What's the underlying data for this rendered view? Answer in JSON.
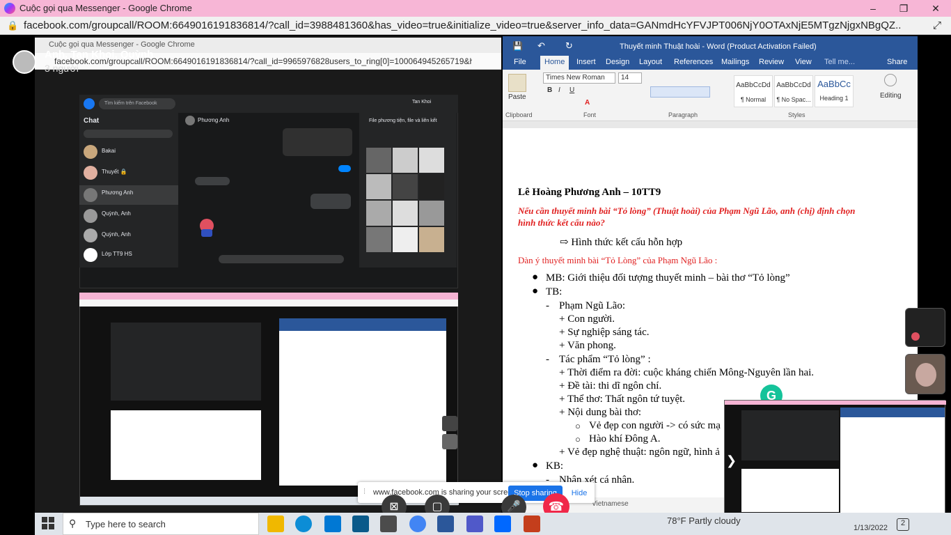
{
  "window": {
    "title": "Cuộc gọi qua Messenger - Google Chrome",
    "minimize": "–",
    "maximize": "❐",
    "close": "✕"
  },
  "address": {
    "lock": "🔒",
    "url": "facebook.com/groupcall/ROOM:6649016191836814/?call_id=3988481360&has_video=true&initialize_video=true&server_info_data=GANmdHcYFVJPT006NjY0OTAxNjE5MTgzNjgxNBgQZ...",
    "ext": "⤢"
  },
  "call": {
    "participants": "Anh, Tan Khoi, Quỳnh",
    "count": "3 người"
  },
  "shared_chrome": {
    "title": "Cuộc gọi qua Messenger - Google Chrome",
    "url": "facebook.com/groupcall/ROOM:6649016191836814/?call_id=9965976828users_to_ring[0]=100064945265719&h..."
  },
  "fb": {
    "search_placeholder": "Tìm kiếm trên Facebook",
    "chat_title": "Chat",
    "contact_name": "Phương Anh",
    "user_name": "Tan Khoi",
    "files_title": "File phương tiện, file và liên kết",
    "chats": [
      {
        "name": "Bakai"
      },
      {
        "name": "Thuyết 🔒"
      },
      {
        "name": "Phương Anh"
      },
      {
        "name": "Quỳnh, Anh"
      },
      {
        "name": "Quỳnh, Anh"
      },
      {
        "name": "Lớp TT9 HS"
      }
    ]
  },
  "word": {
    "title": "Thuyết minh Thuật hoài - Word (Product Activation Failed)",
    "tabs": [
      "File",
      "Home",
      "Insert",
      "Design",
      "Layout",
      "References",
      "Mailings",
      "Review",
      "View"
    ],
    "tell_me": "Tell me...",
    "share": "Share",
    "paste": "Paste",
    "clipboard": "Clipboard",
    "font_group": "Font",
    "paragraph_group": "Paragraph",
    "styles_group": "Styles",
    "font_name": "Times New Roman",
    "font_size": "14",
    "styles": [
      {
        "sample": "AaBbCcDd",
        "name": "¶ Normal"
      },
      {
        "sample": "AaBbCcDd",
        "name": "¶ No Spac..."
      },
      {
        "sample": "AaBbCc",
        "name": "Heading 1"
      }
    ],
    "editing": "Editing",
    "language": "Vietnamese"
  },
  "doc": {
    "author": "Lê Hoàng Phương Anh – 10TT9",
    "question_line1": "Nếu cần thuyết minh bài “Tỏ lòng” (Thuật hoài) của Phạm Ngũ Lão, anh (chị) định chọn",
    "question_line2": "hình thức kết cấu nào?",
    "answer": "⇨  Hình thức kết cấu hỗn hợp",
    "outline_title": "Dàn ý thuyết minh bài “Tỏ Lòng” của Phạm Ngũ Lão :",
    "mb": "MB: Giới thiệu đối tượng thuyết minh – bài thơ “Tỏ lòng”",
    "tb": "TB:",
    "author_head": "Phạm Ngũ Lão:",
    "author_items": [
      "+ Con người.",
      "+ Sự nghiệp sáng tác.",
      "+ Văn phong."
    ],
    "work_head": "Tác phẩm “Tỏ lòng” :",
    "work_items": [
      "+ Thời điểm ra đời: cuộc kháng chiến Mông-Nguyên lần hai.",
      "+ Đề tài: thi dĩ ngôn chí.",
      "+ Thể thơ: Thất ngôn tứ tuyệt.",
      "+ Nội dung bài thơ:"
    ],
    "content_items": [
      "Vẻ đẹp con người -> có sức mạ",
      "Hào khí Đông A."
    ],
    "art": "+ Vẻ đẹp nghệ thuật: ngôn ngữ, hình ả",
    "kb": "KB:",
    "kb_item": "Nhận xét cá nhân."
  },
  "sharing": {
    "text": "www.facebook.com is sharing your screen.",
    "stop": "Stop sharing",
    "hide": "Hide"
  },
  "taskbar": {
    "search_placeholder": "Type here to search",
    "weather": "78°F  Partly cloudy",
    "date": "1/13/2022",
    "notif": "2"
  },
  "colors": {
    "titlebar": "#f7b6d6",
    "word_blue": "#2b579a",
    "end_call_red": "#f02849",
    "share_blue": "#1a73e8"
  }
}
